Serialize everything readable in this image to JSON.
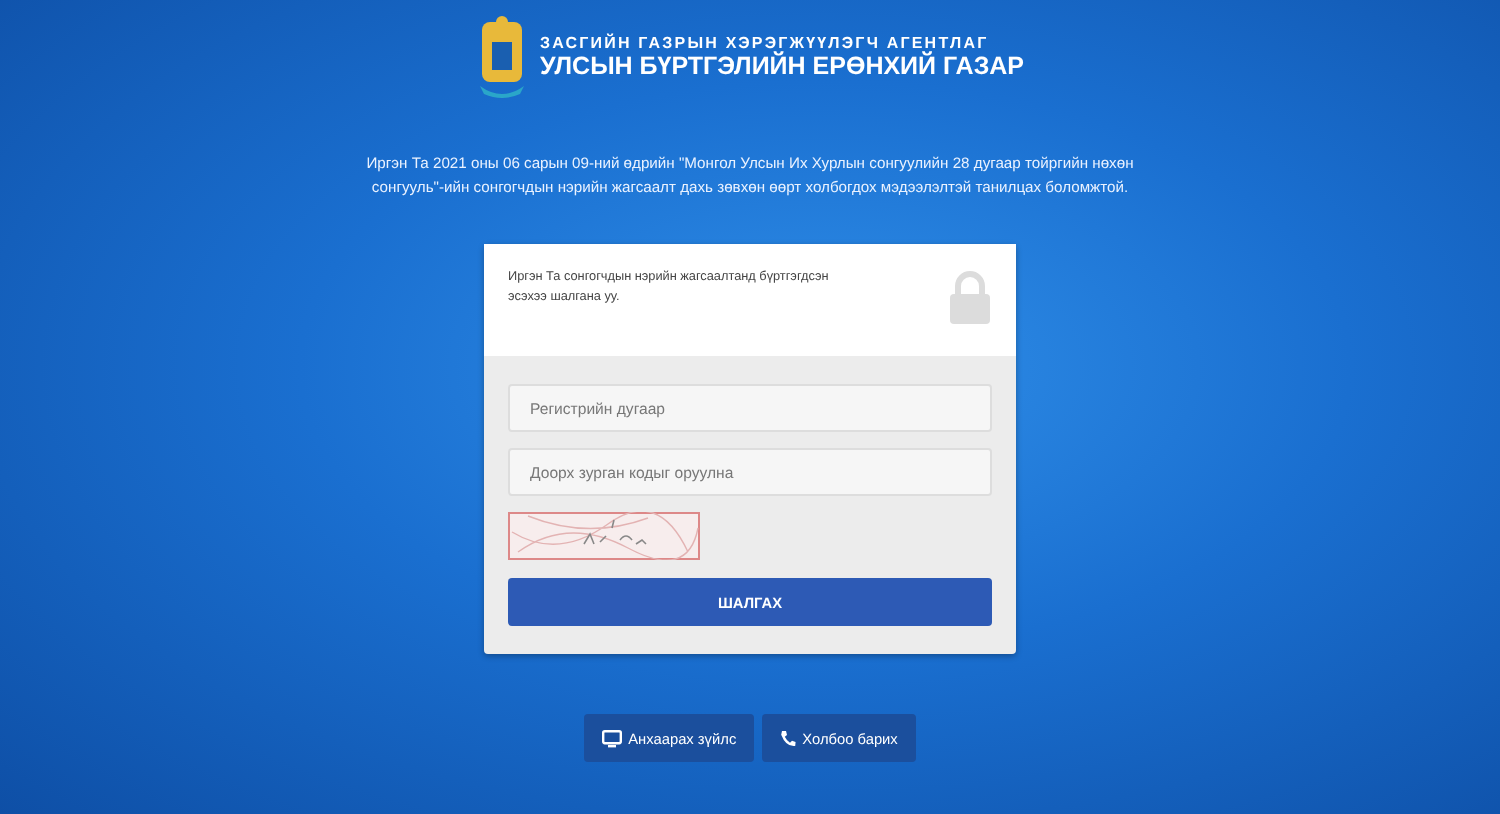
{
  "header": {
    "agency_line": "ЗАСГИЙН ГАЗРЫН ХЭРЭГЖҮҮЛЭГЧ АГЕНТЛАГ",
    "title_line": "УЛСЫН БҮРТГЭЛИЙН ЕРӨНХИЙ ГАЗАР"
  },
  "intro": "Иргэн Та 2021 оны 06 сарын 09-ний өдрийн \"Монгол Улсын Их Хурлын сонгуулийн 28 дугаар тойргийн нөхөн сонгууль\"-ийн сонгогчдын нэрийн жагсаалт дахь зөвхөн өөрт холбогдох мэдээлэлтэй танилцах боломжтой.",
  "card": {
    "notice": "Иргэн Та сонгогчдын нэрийн жагсаалтанд бүртгэгдсэн эсэхээ шалгана уу.",
    "fields": [
      {
        "placeholder": "Регистрийн дугаар"
      },
      {
        "placeholder": "Доорх зурган кодыг оруулна"
      }
    ],
    "submit": "ШАЛГАХ"
  },
  "footer_buttons": [
    {
      "kind": "monitor",
      "label": "Анхаарах зүйлс"
    },
    {
      "kind": "phone",
      "label": "Холбоо барих"
    }
  ]
}
